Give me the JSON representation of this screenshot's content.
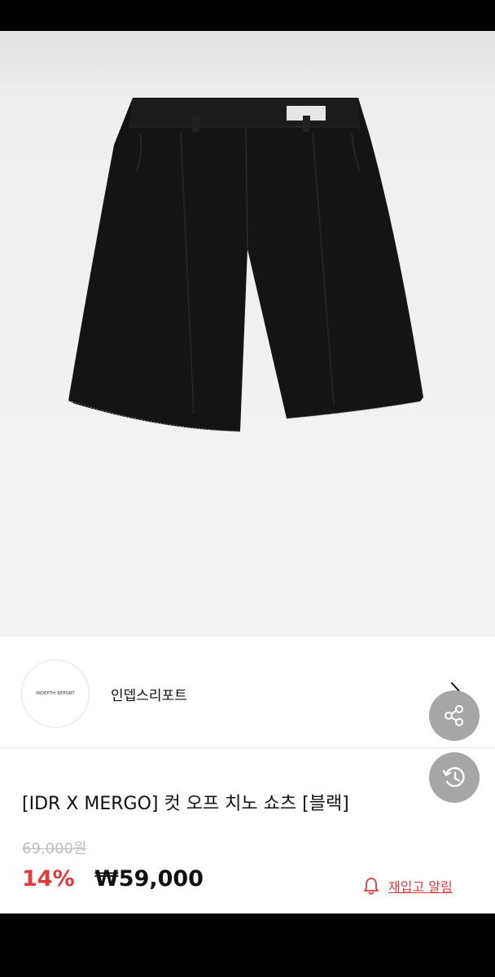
{
  "brand": {
    "logo_text": "INDEPTH REPORT",
    "name": "인뎁스리포트"
  },
  "product": {
    "title": "[IDR X MERGO] 컷 오프 치노 쇼츠 [블랙]",
    "original_price": "69,000원",
    "discount": "14%",
    "sale_price": "₩59,000",
    "image_subject": "black-cutoff-chino-shorts"
  },
  "actions": {
    "restock_alert": "재입고 알림"
  },
  "icons": {
    "share": "share-icon",
    "history": "history-icon",
    "bell": "bell-icon",
    "chevron": "chevron-right-icon"
  },
  "colors": {
    "accent_red": "#e23a3a",
    "fab_gray": "#a6a6a6"
  }
}
